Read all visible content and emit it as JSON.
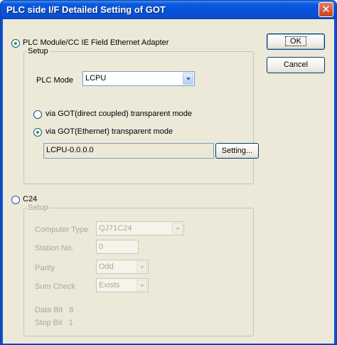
{
  "window": {
    "title": "PLC side I/F Detailed Setting of GOT",
    "close_glyph": "✕"
  },
  "buttons": {
    "ok": "OK",
    "cancel": "Cancel",
    "setting": "Setting..."
  },
  "plc_module": {
    "label": "PLC Module/CC IE Field Ethernet Adapter",
    "selected": true,
    "group_legend": "Setup",
    "plc_mode_label": "PLC Mode",
    "plc_mode_value": "LCPU",
    "direct_label": "via GOT(direct coupled) transparent mode",
    "ethernet_label": "via GOT(Ethernet) transparent mode",
    "ethernet_selected": true,
    "connection_value": "LCPU-0.0.0.0"
  },
  "c24": {
    "label": "C24",
    "selected": false,
    "group_legend": "Setup",
    "computer_type_label": "Computer Type",
    "computer_type_value": "QJ71C24",
    "station_label": "Station No.",
    "station_value": "0",
    "parity_label": "Parity",
    "parity_value": "Odd",
    "sum_check_label": "Sum Check",
    "sum_check_value": "Exists",
    "data_bit_text": "Data Bit   8",
    "stop_bit_text": "Stop Bit   1"
  }
}
